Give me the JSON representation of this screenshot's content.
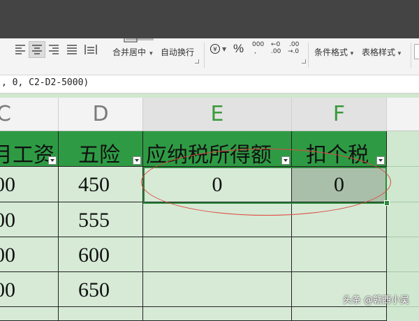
{
  "ribbon": {
    "merge_center": "合并居中",
    "auto_wrap": "自动换行",
    "percent": "%",
    "thousands_top": "000",
    "thousands_bottom": ",",
    "dec_inc_top": "←0",
    "dec_inc_bottom": ".00",
    "dec_dec_top": ".00",
    "dec_dec_bottom": "→.0",
    "cond_format": "条件格式",
    "table_style": "表格样式"
  },
  "formula_bar": {
    "text": ", 0, C2-D2-5000)"
  },
  "columns": {
    "c": "C",
    "d": "D",
    "e": "E",
    "f": "F"
  },
  "headers": {
    "c": "月工资",
    "d": "五险",
    "e": "应纳税所得额",
    "f": "扣个税"
  },
  "rows": [
    {
      "c": "00",
      "d": "450",
      "e": "0",
      "f": "0"
    },
    {
      "c": "00",
      "d": "555",
      "e": "",
      "f": ""
    },
    {
      "c": "00",
      "d": "600",
      "e": "",
      "f": ""
    },
    {
      "c": "00",
      "d": "650",
      "e": "",
      "f": ""
    }
  ],
  "watermark": "头条 @赣西小吴",
  "colors": {
    "header_green": "#2e9b44",
    "sheet_bg": "#d6ead6",
    "selection": "#2a8a3a",
    "annotation": "#e0463e"
  }
}
